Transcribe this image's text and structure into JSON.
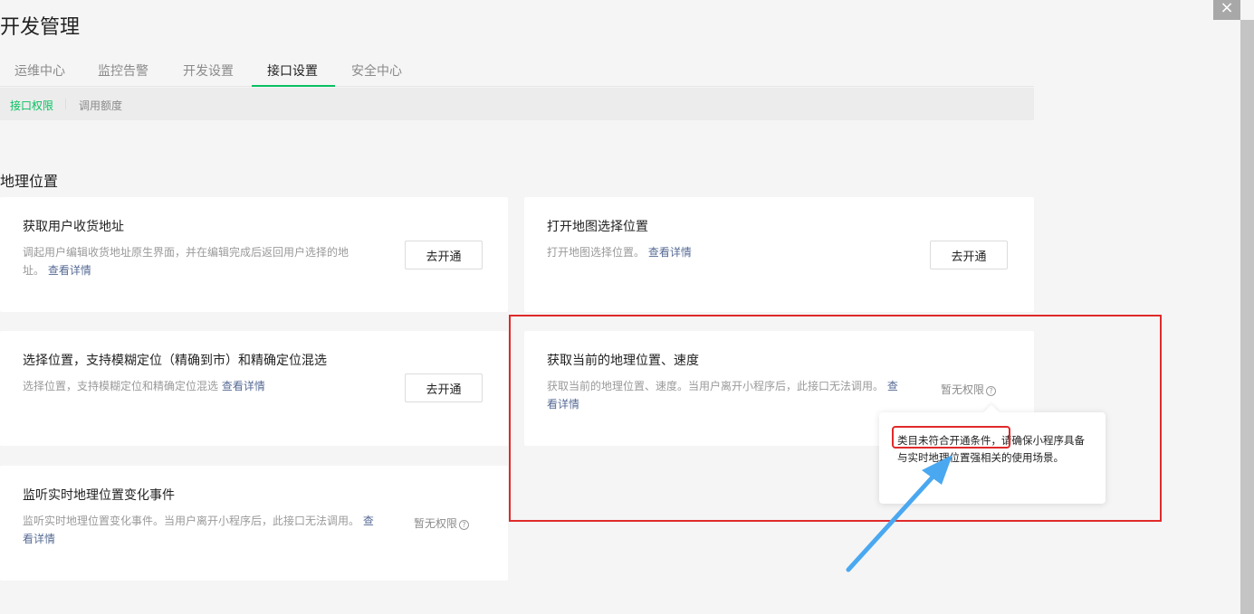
{
  "page": {
    "title": "开发管理"
  },
  "tabs": [
    {
      "label": "运维中心"
    },
    {
      "label": "监控告警"
    },
    {
      "label": "开发设置"
    },
    {
      "label": "接口设置",
      "active": true
    },
    {
      "label": "安全中心"
    }
  ],
  "subnav": [
    {
      "label": "接口权限",
      "active": true
    },
    {
      "label": "调用额度"
    }
  ],
  "section": {
    "title": "地理位置"
  },
  "cards": [
    {
      "title": "获取用户收货地址",
      "desc": "调起用户编辑收货地址原生界面，并在编辑完成后返回用户选择的地址。",
      "link": "查看详情",
      "action": "去开通"
    },
    {
      "title": "打开地图选择位置",
      "desc": "打开地图选择位置。",
      "link": "查看详情",
      "action": "去开通"
    },
    {
      "title": "选择位置，支持模糊定位（精确到市）和精确定位混选",
      "desc": "选择位置，支持模糊定位和精确定位混选",
      "link": "查看详情",
      "action": "去开通"
    },
    {
      "title": "获取当前的地理位置、速度",
      "desc": "获取当前的地理位置、速度。当用户离开小程序后，此接口无法调用。",
      "link": "查看详情",
      "status": "暂无权限"
    },
    {
      "title": "监听实时地理位置变化事件",
      "desc": "监听实时地理位置变化事件。当用户离开小程序后，此接口无法调用。",
      "link": "查看详情",
      "status": "暂无权限"
    }
  ],
  "tooltip": {
    "text": "类目未符合开通条件，请确保小程序具备与实时地理位置强相关的使用场景。"
  },
  "icons": {
    "help": "?",
    "close": "×"
  },
  "colors": {
    "accent": "#07c160",
    "link": "#576b95",
    "annotation": "#e02a2a",
    "arrow": "#4aa8f0"
  }
}
